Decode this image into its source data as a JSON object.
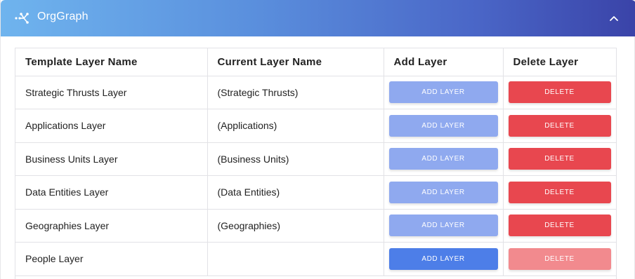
{
  "header": {
    "title": "OrgGraph",
    "logo_icon": "network-graph-icon",
    "collapse_icon": "chevron-up-icon",
    "gradient": [
      "#6fb4ee",
      "#3a43a8"
    ]
  },
  "table": {
    "columns": [
      "Template Layer Name",
      "Current Layer Name",
      "Add Layer",
      "Delete Layer"
    ],
    "rows": [
      {
        "template": "Strategic Thrusts Layer",
        "current": "(Strategic Thrusts)",
        "add_label": "ADD LAYER",
        "delete_label": "DELETE"
      },
      {
        "template": "Applications Layer",
        "current": "(Applications)",
        "add_label": "ADD LAYER",
        "delete_label": "DELETE"
      },
      {
        "template": "Business Units Layer",
        "current": "(Business Units)",
        "add_label": "ADD LAYER",
        "delete_label": "DELETE"
      },
      {
        "template": "Data Entities Layer",
        "current": "(Data Entities)",
        "add_label": "ADD LAYER",
        "delete_label": "DELETE"
      },
      {
        "template": "Geographies Layer",
        "current": "(Geographies)",
        "add_label": "ADD LAYER",
        "delete_label": "DELETE"
      },
      {
        "template": "People Layer",
        "current": "",
        "add_label": "ADD LAYER",
        "delete_label": "DELETE"
      }
    ]
  },
  "colors": {
    "add_button": "#8fa9ef",
    "add_button_active": "#4d7ee8",
    "delete_button": "#e8474f",
    "delete_button_disabled": "#f28a8e"
  }
}
